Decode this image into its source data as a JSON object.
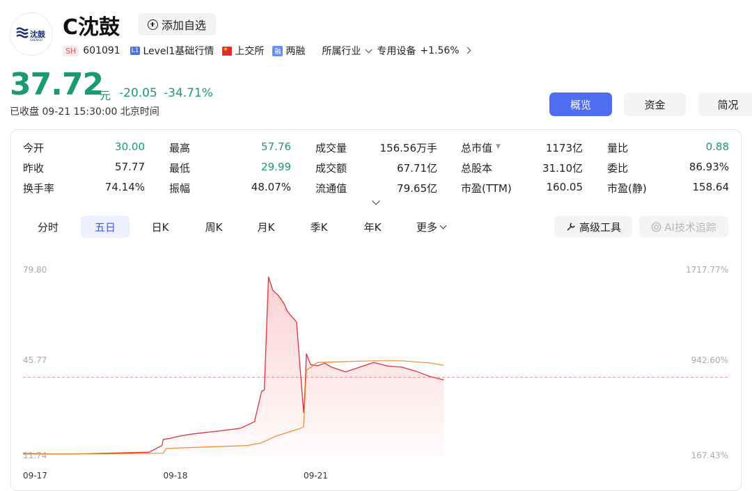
{
  "stock": {
    "logo_text": "沈鼓",
    "logo_sub": "SHENGU",
    "name": "C沈鼓",
    "watch_label": "添加自选",
    "market_badge": "SH",
    "code": "601091",
    "level_badge": "L1",
    "level_label": "Level1基础行情",
    "exchange": "上交所",
    "margin_badge": "融",
    "margin_label": "两融",
    "industry_label": "所属行业",
    "industry_name": "专用设备",
    "industry_change": "+1.56%"
  },
  "price": {
    "current": "37.72",
    "unit": "元",
    "change": "-20.05",
    "change_pct": "-34.71%",
    "status": "已收盘",
    "time": "09-21 15:30:00",
    "timezone": "北京时间"
  },
  "view_tabs": [
    "概览",
    "资金",
    "简况"
  ],
  "quotes": [
    [
      {
        "label": "今开",
        "value": "30.00",
        "color": "green"
      },
      {
        "label": "最高",
        "value": "57.76",
        "color": "green"
      },
      {
        "label": "成交量",
        "value": "156.56万手",
        "color": ""
      },
      {
        "label": "总市值",
        "value": "1173亿",
        "color": "",
        "caret": true
      },
      {
        "label": "量比",
        "value": "0.88",
        "color": "green"
      }
    ],
    [
      {
        "label": "昨收",
        "value": "57.77",
        "color": ""
      },
      {
        "label": "最低",
        "value": "29.99",
        "color": "green"
      },
      {
        "label": "成交额",
        "value": "67.71亿",
        "color": ""
      },
      {
        "label": "总股本",
        "value": "31.10亿",
        "color": ""
      },
      {
        "label": "委比",
        "value": "86.93%",
        "color": ""
      }
    ],
    [
      {
        "label": "换手率",
        "value": "74.14%",
        "color": ""
      },
      {
        "label": "振幅",
        "value": "48.07%",
        "color": ""
      },
      {
        "label": "流通值",
        "value": "79.65亿",
        "color": ""
      },
      {
        "label": "市盈(TTM)",
        "value": "160.05",
        "color": ""
      },
      {
        "label": "市盈(静)",
        "value": "158.64",
        "color": ""
      }
    ]
  ],
  "periods": [
    "分时",
    "五日",
    "日K",
    "周K",
    "月K",
    "季K",
    "年K",
    "更多"
  ],
  "active_period": "五日",
  "tools": {
    "advanced": "高级工具",
    "ai": "AI技术追踪"
  },
  "colors": {
    "accent": "#4f6df0",
    "down": "#1a9b6c",
    "price_line": "#e0303a",
    "avg_line": "#f08a2c"
  },
  "chart_data": {
    "type": "line",
    "title": "",
    "y_ticks_left": [
      "79.80",
      "45.77",
      "11.74"
    ],
    "y_ticks_right": [
      "1717.77%",
      "942.60%",
      "167.43%"
    ],
    "ylim": [
      11.74,
      79.8
    ],
    "prev_close": 41.2,
    "x_ticks": [
      {
        "label": "09-17",
        "t": 0
      },
      {
        "label": "09-18",
        "t": 1
      },
      {
        "label": "09-21",
        "t": 2
      }
    ],
    "xlim": [
      0,
      5
    ],
    "series": [
      {
        "name": "",
        "values_t": [
          0,
          0.3,
          0.6,
          0.9,
          0.99,
          1.0,
          1.05,
          1.1,
          1.2,
          1.4,
          1.55,
          1.65,
          1.7,
          1.72,
          1.75,
          1.78,
          1.82,
          1.86,
          1.88,
          1.9,
          1.95,
          2.0,
          2.01,
          2.02,
          2.05,
          2.1,
          2.15,
          2.2,
          2.3,
          2.4,
          2.5,
          2.6,
          2.7,
          2.8,
          2.9,
          3.0
        ],
        "values": [
          12.5,
          12.3,
          12.6,
          13.0,
          15.5,
          17.8,
          18.2,
          18.9,
          19.8,
          21.0,
          22.0,
          24.5,
          35.8,
          36.5,
          79.0,
          74.0,
          72.0,
          69.0,
          66.5,
          65.0,
          62.0,
          28.0,
          36.2,
          50.0,
          46.0,
          45.5,
          46.5,
          45.0,
          43.2,
          45.0,
          46.8,
          45.4,
          45.0,
          43.5,
          41.5,
          40.2
        ]
      },
      {
        "name": "",
        "values_t": [
          0,
          0.6,
          1.0,
          1.02,
          1.6,
          1.7,
          1.8,
          1.98,
          2.0,
          2.02,
          2.1,
          2.3,
          2.5,
          2.7,
          2.9,
          3.0
        ],
        "values": [
          12.3,
          12.4,
          12.6,
          14.4,
          15.5,
          16.5,
          19.0,
          22.0,
          22.5,
          43.8,
          46.8,
          47.1,
          47.4,
          47.4,
          46.6,
          45.7
        ]
      }
    ]
  }
}
